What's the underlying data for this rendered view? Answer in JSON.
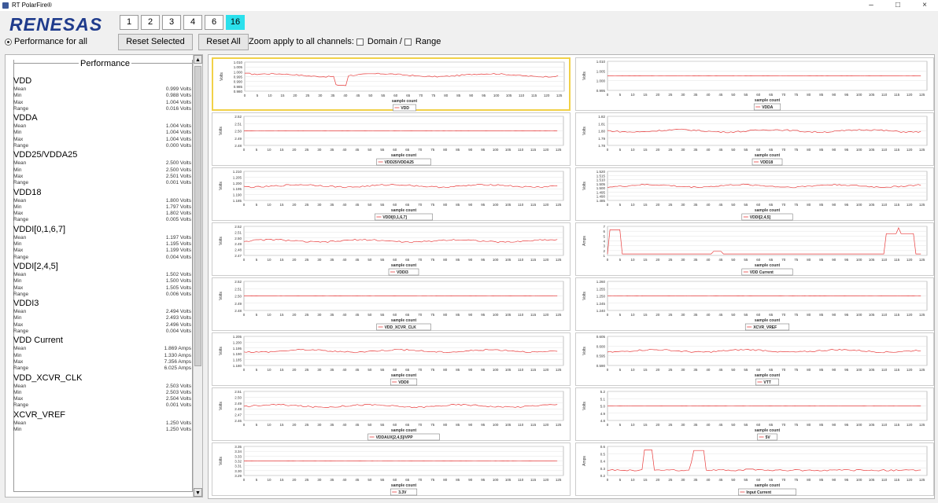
{
  "window": {
    "title": "RT PolarFire®",
    "controls": [
      "–",
      "□",
      "×"
    ]
  },
  "logo": "RENESAS",
  "pages": [
    {
      "label": "1",
      "active": false
    },
    {
      "label": "2",
      "active": false
    },
    {
      "label": "3",
      "active": false
    },
    {
      "label": "4",
      "active": false
    },
    {
      "label": "6",
      "active": false
    },
    {
      "label": "16",
      "active": true
    }
  ],
  "toolbar": {
    "performance_for_all": "Performance for all",
    "reset_selected": "Reset Selected",
    "reset_all": "Reset All",
    "zoom_label": "Zoom apply to all channels:",
    "domain": "Domain",
    "slash": "/",
    "range": "Range"
  },
  "performance": {
    "title": "Performance",
    "rails": [
      {
        "name": "VDD",
        "stats": [
          [
            "Mean",
            "0.999 Volts"
          ],
          [
            "Min",
            "0.988 Volts"
          ],
          [
            "Max",
            "1.004 Volts"
          ],
          [
            "Range",
            "0.016 Volts"
          ]
        ]
      },
      {
        "name": "VDDA",
        "stats": [
          [
            "Mean",
            "1.004 Volts"
          ],
          [
            "Min",
            "1.004 Volts"
          ],
          [
            "Max",
            "1.004 Volts"
          ],
          [
            "Range",
            "0.000 Volts"
          ]
        ]
      },
      {
        "name": "VDD25/VDDA25",
        "stats": [
          [
            "Mean",
            "2.500 Volts"
          ],
          [
            "Min",
            "2.500 Volts"
          ],
          [
            "Max",
            "2.501 Volts"
          ],
          [
            "Range",
            "0.001 Volts"
          ]
        ]
      },
      {
        "name": "VDD18",
        "stats": [
          [
            "Mean",
            "1.800 Volts"
          ],
          [
            "Min",
            "1.797 Volts"
          ],
          [
            "Max",
            "1.802 Volts"
          ],
          [
            "Range",
            "0.005 Volts"
          ]
        ]
      },
      {
        "name": "VDDI[0,1,6,7]",
        "stats": [
          [
            "Mean",
            "1.197 Volts"
          ],
          [
            "Min",
            "1.195 Volts"
          ],
          [
            "Max",
            "1.199 Volts"
          ],
          [
            "Range",
            "0.004 Volts"
          ]
        ]
      },
      {
        "name": "VDDI[2,4,5]",
        "stats": [
          [
            "Mean",
            "1.502 Volts"
          ],
          [
            "Min",
            "1.500 Volts"
          ],
          [
            "Max",
            "1.505 Volts"
          ],
          [
            "Range",
            "0.006 Volts"
          ]
        ]
      },
      {
        "name": "VDDI3",
        "stats": [
          [
            "Mean",
            "2.494 Volts"
          ],
          [
            "Min",
            "2.493 Volts"
          ],
          [
            "Max",
            "2.496 Volts"
          ],
          [
            "Range",
            "0.004 Volts"
          ]
        ]
      },
      {
        "name": "VDD Current",
        "stats": [
          [
            "Mean",
            "1.869 Amps"
          ],
          [
            "Min",
            "1.330 Amps"
          ],
          [
            "Max",
            "7.356 Amps"
          ],
          [
            "Range",
            "6.025 Amps"
          ]
        ]
      },
      {
        "name": "VDD_XCVR_CLK",
        "stats": [
          [
            "Mean",
            "2.503 Volts"
          ],
          [
            "Min",
            "2.503 Volts"
          ],
          [
            "Max",
            "2.504 Volts"
          ],
          [
            "Range",
            "0.001 Volts"
          ]
        ]
      },
      {
        "name": "XCVR_VREF",
        "stats": [
          [
            "Mean",
            "1.250 Volts"
          ],
          [
            "Min",
            "1.250 Volts"
          ]
        ]
      }
    ]
  },
  "chart_data": [
    {
      "type": "line",
      "legend": "VDD",
      "ylabel": "Volts",
      "xlabel": "sample count",
      "yticks": [
        "1.010",
        "1.005",
        "1.000",
        "0.995",
        "0.990",
        "0.985",
        "0.980"
      ],
      "ylim": [
        0.98,
        1.01
      ],
      "xticks": [
        "0",
        "5",
        "10",
        "15",
        "20",
        "25",
        "30",
        "35",
        "40",
        "45",
        "50",
        "55",
        "60",
        "65",
        "70",
        "75",
        "80",
        "85",
        "90",
        "95",
        "100",
        "105",
        "110",
        "115",
        "120",
        "125"
      ],
      "shape": "vdd"
    },
    {
      "type": "line",
      "legend": "VDDA",
      "ylabel": "Volts",
      "xlabel": "sample count",
      "yticks": [
        "1.010",
        "1.005",
        "1.000",
        "0.995"
      ],
      "ylim": [
        0.995,
        1.01
      ],
      "xticks": [
        "0",
        "5",
        "10",
        "15",
        "20",
        "25",
        "30",
        "35",
        "40",
        "45",
        "50",
        "55",
        "60",
        "65",
        "70",
        "75",
        "80",
        "85",
        "90",
        "95",
        "100",
        "105",
        "110",
        "115",
        "120",
        "125"
      ],
      "shape": "flat"
    },
    {
      "type": "line",
      "legend": "VDD25/VDDA25",
      "ylabel": "Volts",
      "xlabel": "sample count",
      "yticks": [
        "2.52",
        "2.51",
        "2.50",
        "2.49",
        "2.48"
      ],
      "ylim": [
        2.48,
        2.52
      ],
      "xticks": [
        "0",
        "5",
        "10",
        "15",
        "20",
        "25",
        "30",
        "35",
        "40",
        "45",
        "50",
        "55",
        "60",
        "65",
        "70",
        "75",
        "80",
        "85",
        "90",
        "95",
        "100",
        "105",
        "110",
        "115",
        "120",
        "125"
      ],
      "shape": "flat"
    },
    {
      "type": "line",
      "legend": "VDD18",
      "ylabel": "Volts",
      "xlabel": "sample count",
      "yticks": [
        "1.82",
        "1.81",
        "1.80",
        "1.79",
        "1.78"
      ],
      "ylim": [
        1.78,
        1.82
      ],
      "xticks": [
        "0",
        "5",
        "10",
        "15",
        "20",
        "25",
        "30",
        "35",
        "40",
        "45",
        "50",
        "55",
        "60",
        "65",
        "70",
        "75",
        "80",
        "85",
        "90",
        "95",
        "100",
        "105",
        "110",
        "115",
        "120",
        "125"
      ],
      "shape": "noise"
    },
    {
      "type": "line",
      "legend": "VDDI[0,1,6,7]",
      "ylabel": "Volts",
      "xlabel": "sample count",
      "yticks": [
        "1.210",
        "1.205",
        "1.200",
        "1.195",
        "1.190",
        "1.185"
      ],
      "ylim": [
        1.185,
        1.21
      ],
      "xticks": [
        "0",
        "5",
        "10",
        "15",
        "20",
        "25",
        "30",
        "35",
        "40",
        "45",
        "50",
        "55",
        "60",
        "65",
        "70",
        "75",
        "80",
        "85",
        "90",
        "95",
        "100",
        "105",
        "110",
        "115",
        "120",
        "125"
      ],
      "shape": "noise"
    },
    {
      "type": "line",
      "legend": "VDDI[2,4,5]",
      "ylabel": "Volts",
      "xlabel": "sample count",
      "yticks": [
        "1.520",
        "1.515",
        "1.510",
        "1.505",
        "1.500",
        "1.495",
        "1.490",
        "1.485"
      ],
      "ylim": [
        1.485,
        1.52
      ],
      "xticks": [
        "0",
        "5",
        "10",
        "15",
        "20",
        "25",
        "30",
        "35",
        "40",
        "45",
        "50",
        "55",
        "60",
        "65",
        "70",
        "75",
        "80",
        "85",
        "90",
        "95",
        "100",
        "105",
        "110",
        "115",
        "120",
        "125"
      ],
      "shape": "noise"
    },
    {
      "type": "line",
      "legend": "VDDI3",
      "ylabel": "Volts",
      "xlabel": "sample count",
      "yticks": [
        "2.52",
        "2.51",
        "2.50",
        "2.49",
        "2.48",
        "2.47"
      ],
      "ylim": [
        2.47,
        2.52
      ],
      "xticks": [
        "0",
        "5",
        "10",
        "15",
        "20",
        "25",
        "30",
        "35",
        "40",
        "45",
        "50",
        "55",
        "60",
        "65",
        "70",
        "75",
        "80",
        "85",
        "90",
        "95",
        "100",
        "105",
        "110",
        "115",
        "120",
        "125"
      ],
      "shape": "noise"
    },
    {
      "type": "line",
      "legend": "VDD Current",
      "ylabel": "Amps",
      "xlabel": "sample count",
      "yticks": [
        "7",
        "6",
        "5",
        "4",
        "3",
        "2",
        "1"
      ],
      "ylim": [
        1,
        7.5
      ],
      "xticks": [
        "0",
        "5",
        "10",
        "15",
        "20",
        "25",
        "30",
        "35",
        "40",
        "45",
        "50",
        "55",
        "60",
        "65",
        "70",
        "75",
        "80",
        "85",
        "90",
        "95",
        "100",
        "105",
        "110",
        "115",
        "120",
        "125"
      ],
      "shape": "current"
    },
    {
      "type": "line",
      "legend": "VDD_XCVR_CLK",
      "ylabel": "Volts",
      "xlabel": "sample count",
      "yticks": [
        "2.52",
        "2.51",
        "2.50",
        "2.49",
        "2.48"
      ],
      "ylim": [
        2.48,
        2.52
      ],
      "xticks": [
        "0",
        "5",
        "10",
        "15",
        "20",
        "25",
        "30",
        "35",
        "40",
        "45",
        "50",
        "55",
        "60",
        "65",
        "70",
        "75",
        "80",
        "85",
        "90",
        "95",
        "100",
        "105",
        "110",
        "115",
        "120",
        "125"
      ],
      "shape": "flat"
    },
    {
      "type": "line",
      "legend": "XCVR_VREF",
      "ylabel": "Volts",
      "xlabel": "sample count",
      "yticks": [
        "1.260",
        "1.255",
        "1.250",
        "1.245",
        "1.240"
      ],
      "ylim": [
        1.24,
        1.26
      ],
      "xticks": [
        "0",
        "5",
        "10",
        "15",
        "20",
        "25",
        "30",
        "35",
        "40",
        "45",
        "50",
        "55",
        "60",
        "65",
        "70",
        "75",
        "80",
        "85",
        "90",
        "95",
        "100",
        "105",
        "110",
        "115",
        "120",
        "125"
      ],
      "shape": "flat"
    },
    {
      "type": "line",
      "legend": "VDD0",
      "ylabel": "Volts",
      "xlabel": "sample count",
      "yticks": [
        "1.205",
        "1.200",
        "1.195",
        "1.190",
        "1.185",
        "1.180"
      ],
      "ylim": [
        1.18,
        1.205
      ],
      "xticks": [
        "0",
        "5",
        "10",
        "15",
        "20",
        "25",
        "30",
        "35",
        "40",
        "45",
        "50",
        "55",
        "60",
        "65",
        "70",
        "75",
        "80",
        "85",
        "90",
        "95",
        "100",
        "105",
        "110",
        "115",
        "120",
        "125"
      ],
      "shape": "noise"
    },
    {
      "type": "line",
      "legend": "VTT",
      "ylabel": "Volts",
      "xlabel": "sample count",
      "yticks": [
        "0.605",
        "0.600",
        "0.595",
        "0.590"
      ],
      "ylim": [
        0.59,
        0.605
      ],
      "xticks": [
        "0",
        "5",
        "10",
        "15",
        "20",
        "25",
        "30",
        "35",
        "40",
        "45",
        "50",
        "55",
        "60",
        "65",
        "70",
        "75",
        "80",
        "85",
        "90",
        "95",
        "100",
        "105",
        "110",
        "115",
        "120",
        "125"
      ],
      "shape": "noise"
    },
    {
      "type": "line",
      "legend": "VDDAUX[2,4,5]/VPP",
      "ylabel": "Volts",
      "xlabel": "sample count",
      "yticks": [
        "2.51",
        "2.50",
        "2.49",
        "2.48",
        "2.47",
        "2.46"
      ],
      "ylim": [
        2.46,
        2.51
      ],
      "xticks": [
        "0",
        "5",
        "10",
        "15",
        "20",
        "25",
        "30",
        "35",
        "40",
        "45",
        "50",
        "55",
        "60",
        "65",
        "70",
        "75",
        "80",
        "85",
        "90",
        "95",
        "100",
        "105",
        "110",
        "115",
        "120",
        "125"
      ],
      "shape": "noise"
    },
    {
      "type": "line",
      "legend": "5V",
      "ylabel": "Volts",
      "xlabel": "sample count",
      "yticks": [
        "5.2",
        "5.1",
        "5.0",
        "4.9",
        "4.8"
      ],
      "ylim": [
        4.8,
        5.2
      ],
      "xticks": [
        "0",
        "5",
        "10",
        "15",
        "20",
        "25",
        "30",
        "35",
        "40",
        "45",
        "50",
        "55",
        "60",
        "65",
        "70",
        "75",
        "80",
        "85",
        "90",
        "95",
        "100",
        "105",
        "110",
        "115",
        "120",
        "125"
      ],
      "shape": "flat"
    },
    {
      "type": "line",
      "legend": "3.3V",
      "ylabel": "Volts",
      "xlabel": "sample count",
      "yticks": [
        "3.35",
        "3.34",
        "3.33",
        "3.32",
        "3.31",
        "3.30",
        "3.29"
      ],
      "ylim": [
        3.29,
        3.35
      ],
      "xticks": [
        "0",
        "5",
        "10",
        "15",
        "20",
        "25",
        "30",
        "35",
        "40",
        "45",
        "50",
        "55",
        "60",
        "65",
        "70",
        "75",
        "80",
        "85",
        "90",
        "95",
        "100",
        "105",
        "110",
        "115",
        "120",
        "125"
      ],
      "shape": "flat"
    },
    {
      "type": "line",
      "legend": "Input Current",
      "ylabel": "Amps",
      "xlabel": "sample count",
      "yticks": [
        "0.6",
        "0.5",
        "0.4",
        "0.3",
        "0.2"
      ],
      "ylim": [
        0.15,
        0.65
      ],
      "xticks": [
        "0",
        "5",
        "10",
        "15",
        "20",
        "25",
        "30",
        "35",
        "40",
        "45",
        "50",
        "55",
        "60",
        "65",
        "70",
        "75",
        "80",
        "85",
        "90",
        "95",
        "100",
        "105",
        "110",
        "115",
        "120",
        "125"
      ],
      "shape": "input"
    }
  ],
  "colors": {
    "accent": "#2be0ec",
    "trace": "#e83c3c",
    "selected_border": "#f1d148",
    "logo": "#1f3b8c"
  }
}
